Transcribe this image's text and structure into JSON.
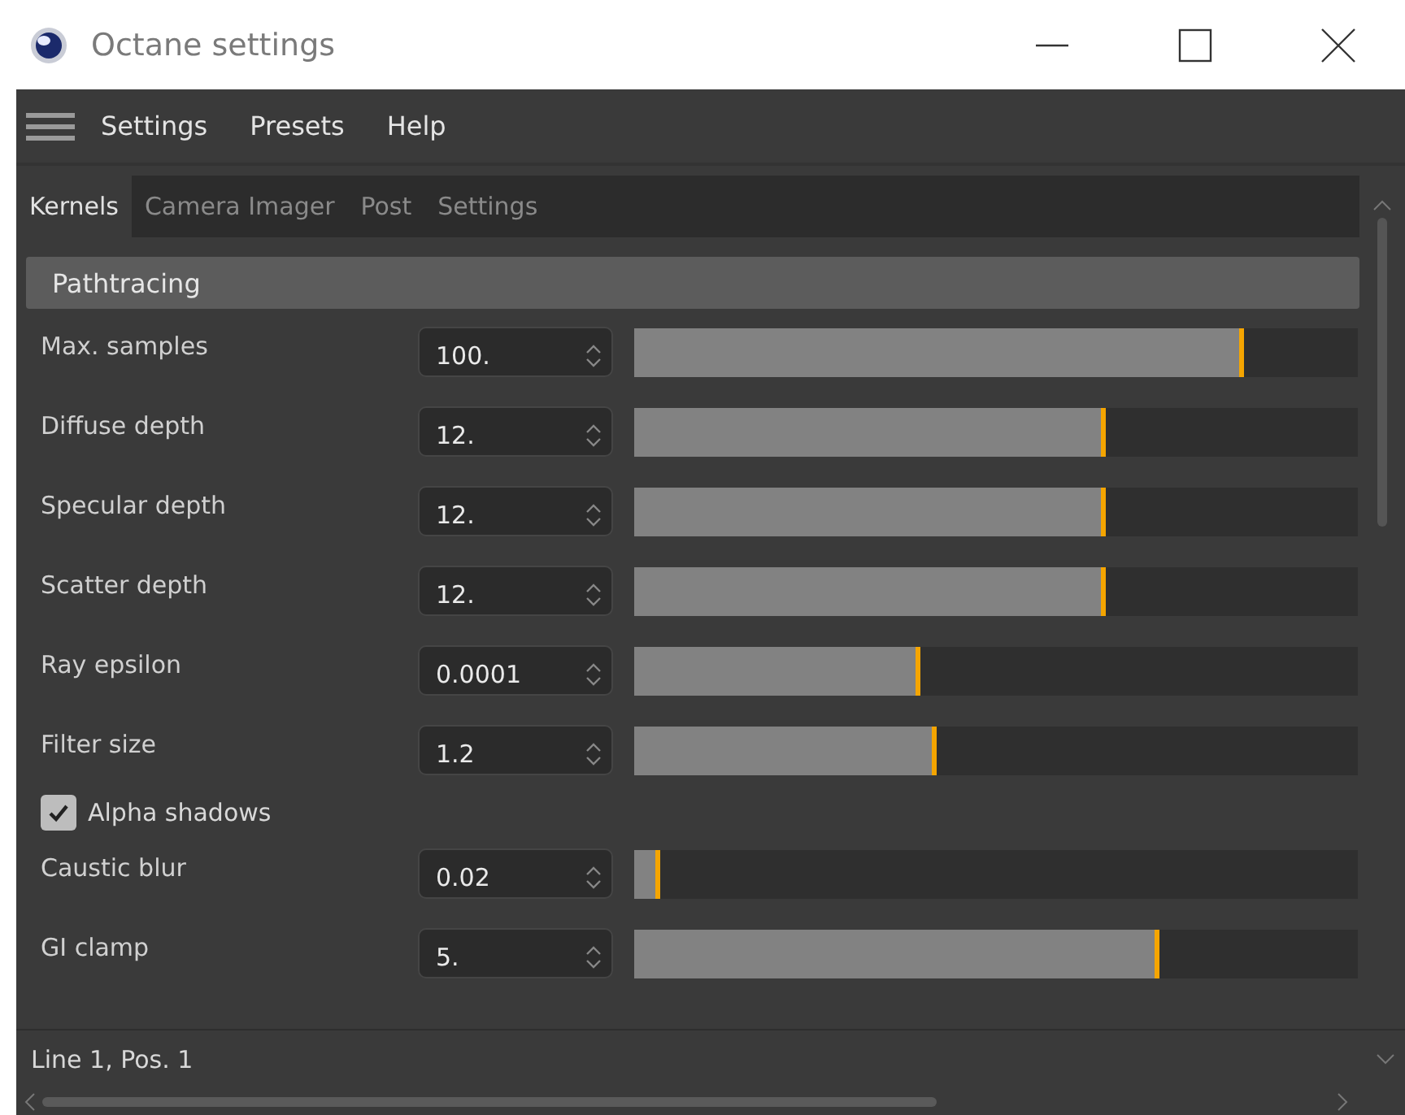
{
  "window": {
    "title": "Octane settings"
  },
  "menu": [
    "Settings",
    "Presets",
    "Help"
  ],
  "tabs": [
    {
      "label": "Kernels",
      "selected": true
    },
    {
      "label": "Camera Imager",
      "selected": false
    },
    {
      "label": "Post",
      "selected": false
    },
    {
      "label": "Settings",
      "selected": false
    }
  ],
  "section": {
    "title": "Pathtracing"
  },
  "items": [
    {
      "kind": "slider",
      "label": "Max. samples",
      "value": "100.",
      "level": 0.843
    },
    {
      "kind": "slider",
      "label": "Diffuse depth",
      "value": "12.",
      "level": 0.652
    },
    {
      "kind": "slider",
      "label": "Specular depth",
      "value": "12.",
      "level": 0.652
    },
    {
      "kind": "slider",
      "label": "Scatter depth",
      "value": "12.",
      "level": 0.652
    },
    {
      "kind": "slider",
      "label": "Ray epsilon",
      "value": "0.0001",
      "level": 0.395
    },
    {
      "kind": "slider",
      "label": "Filter size",
      "value": "1.2",
      "level": 0.419
    },
    {
      "kind": "checkbox",
      "label": "Alpha shadows",
      "checked": true
    },
    {
      "kind": "slider",
      "label": "Caustic blur",
      "value": "0.02",
      "level": 0.036
    },
    {
      "kind": "slider",
      "label": "GI clamp",
      "value": "5.",
      "level": 0.726
    }
  ],
  "status_bar": "Line 1, Pos. 1"
}
